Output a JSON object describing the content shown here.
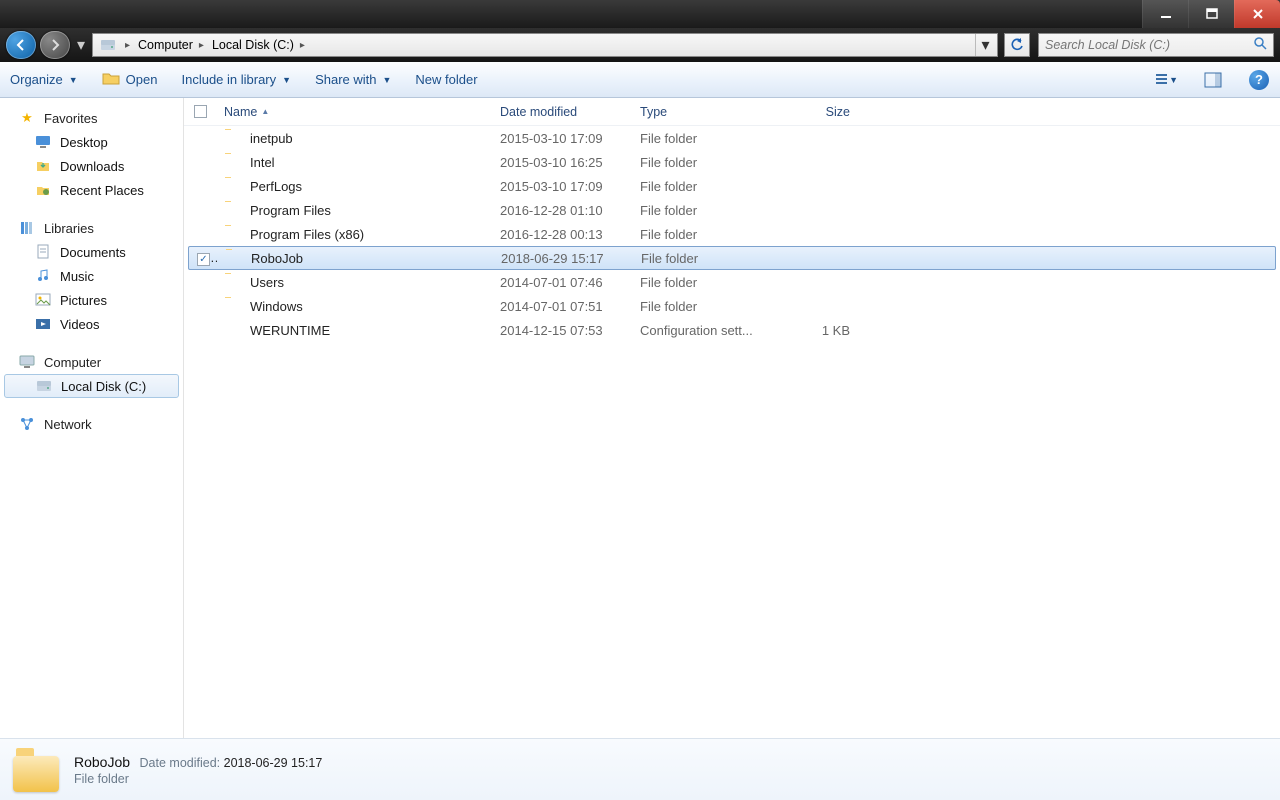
{
  "breadcrumb": {
    "root": "Computer",
    "drive": "Local Disk (C:)"
  },
  "search": {
    "placeholder": "Search Local Disk (C:)"
  },
  "toolbar": {
    "organize": "Organize",
    "open": "Open",
    "include": "Include in library",
    "share": "Share with",
    "newfolder": "New folder"
  },
  "columns": {
    "name": "Name",
    "date": "Date modified",
    "type": "Type",
    "size": "Size"
  },
  "sidebar": {
    "favorites": "Favorites",
    "fav_items": [
      "Desktop",
      "Downloads",
      "Recent Places"
    ],
    "libraries": "Libraries",
    "lib_items": [
      "Documents",
      "Music",
      "Pictures",
      "Videos"
    ],
    "computer": "Computer",
    "comp_items": [
      "Local Disk (C:)"
    ],
    "network": "Network"
  },
  "files": [
    {
      "name": "inetpub",
      "date": "2015-03-10 17:09",
      "type": "File folder",
      "size": "",
      "icon": "folder",
      "selected": false
    },
    {
      "name": "Intel",
      "date": "2015-03-10 16:25",
      "type": "File folder",
      "size": "",
      "icon": "folder",
      "selected": false
    },
    {
      "name": "PerfLogs",
      "date": "2015-03-10 17:09",
      "type": "File folder",
      "size": "",
      "icon": "folder",
      "selected": false
    },
    {
      "name": "Program Files",
      "date": "2016-12-28 01:10",
      "type": "File folder",
      "size": "",
      "icon": "folder",
      "selected": false
    },
    {
      "name": "Program Files (x86)",
      "date": "2016-12-28 00:13",
      "type": "File folder",
      "size": "",
      "icon": "folder",
      "selected": false
    },
    {
      "name": "RoboJob",
      "date": "2018-06-29 15:17",
      "type": "File folder",
      "size": "",
      "icon": "folder",
      "selected": true
    },
    {
      "name": "Users",
      "date": "2014-07-01 07:46",
      "type": "File folder",
      "size": "",
      "icon": "folder",
      "selected": false
    },
    {
      "name": "Windows",
      "date": "2014-07-01 07:51",
      "type": "File folder",
      "size": "",
      "icon": "folder",
      "selected": false
    },
    {
      "name": "WERUNTIME",
      "date": "2014-12-15 07:53",
      "type": "Configuration sett...",
      "size": "1 KB",
      "icon": "config",
      "selected": false
    }
  ],
  "details": {
    "name": "RoboJob",
    "mod_label": "Date modified:",
    "mod_value": "2018-06-29 15:17",
    "type": "File folder"
  }
}
